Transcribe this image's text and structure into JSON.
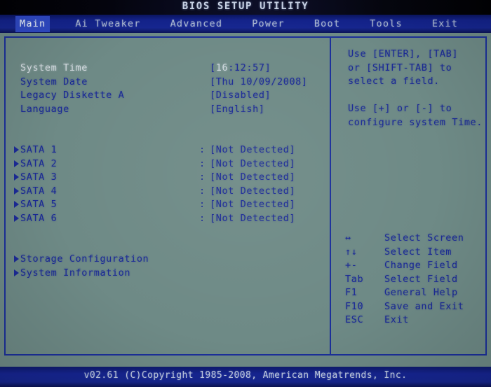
{
  "window": {
    "title": "BIOS SETUP UTILITY"
  },
  "menubar": {
    "items": [
      {
        "label": "Main",
        "active": true
      },
      {
        "label": "Ai Tweaker",
        "active": false
      },
      {
        "label": "Advanced",
        "active": false
      },
      {
        "label": "Power",
        "active": false
      },
      {
        "label": "Boot",
        "active": false
      },
      {
        "label": "Tools",
        "active": false
      },
      {
        "label": "Exit",
        "active": false
      }
    ]
  },
  "main": {
    "settings": [
      {
        "label": "System Time",
        "value_prefix": "[",
        "value_highlight": "16",
        "value_rest": ":12:57]",
        "selected": true
      },
      {
        "label": "System Date",
        "value": "[Thu 10/09/2008]",
        "selected": false
      },
      {
        "label": "Legacy Diskette A",
        "value": "[Disabled]",
        "selected": false
      },
      {
        "label": "Language",
        "value": "[English]",
        "selected": false
      }
    ],
    "drives": [
      {
        "label": "SATA 1",
        "colon": ":",
        "value": "[Not Detected]"
      },
      {
        "label": "SATA 2",
        "colon": ":",
        "value": "[Not Detected]"
      },
      {
        "label": "SATA 3",
        "colon": ":",
        "value": "[Not Detected]"
      },
      {
        "label": "SATA 4",
        "colon": ":",
        "value": "[Not Detected]"
      },
      {
        "label": "SATA 5",
        "colon": ":",
        "value": "[Not Detected]"
      },
      {
        "label": "SATA 6",
        "colon": ":",
        "value": "[Not Detected]"
      }
    ],
    "submenus": [
      {
        "label": "Storage Configuration"
      },
      {
        "label": "System Information"
      }
    ]
  },
  "help": {
    "text": "Use [ENTER], [TAB]\nor [SHIFT-TAB] to\nselect a field.\n\nUse [+] or [-] to\nconfigure system Time."
  },
  "legend": {
    "rows": [
      {
        "key": "↔",
        "desc": "Select Screen"
      },
      {
        "key": "↑↓",
        "desc": "Select Item"
      },
      {
        "key": "+-",
        "desc": "Change Field"
      },
      {
        "key": "Tab",
        "desc": "Select Field"
      },
      {
        "key": "F1",
        "desc": "General Help"
      },
      {
        "key": "F10",
        "desc": "Save and Exit"
      },
      {
        "key": "ESC",
        "desc": "Exit"
      }
    ]
  },
  "footer": {
    "text": "v02.61 (C)Copyright 1985-2008, American Megatrends, Inc."
  },
  "colors": {
    "screen_bg": "#6e8a86",
    "panel_border": "#1b2f9a",
    "text_blue": "#1b2a96",
    "text_selected": "#d6dde2",
    "menubar_blue": "#16268f",
    "menu_active_bg": "#2f49c4",
    "footer_blue": "#16268f"
  }
}
